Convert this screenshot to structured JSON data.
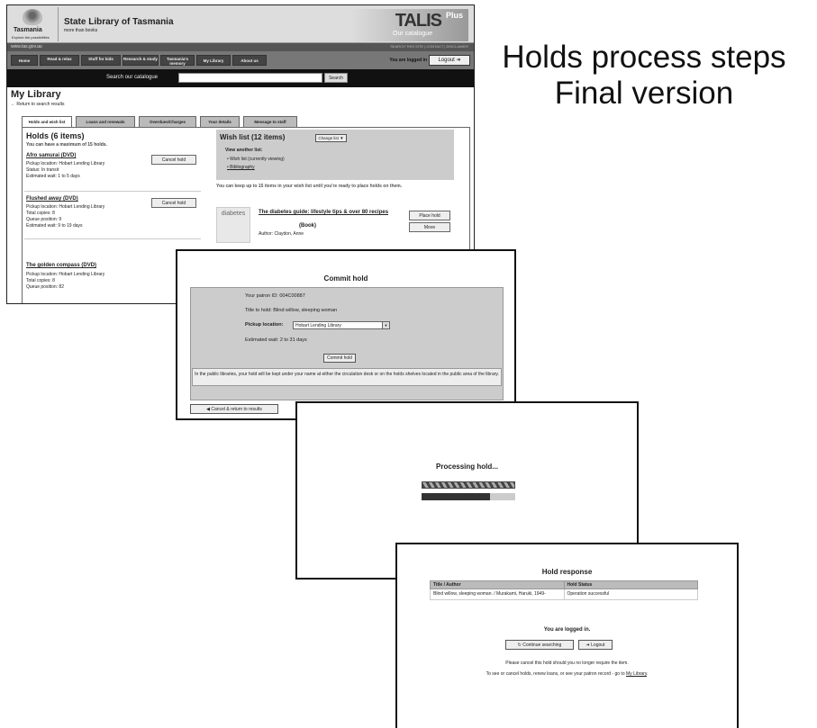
{
  "slide": {
    "title_line1": "Holds process steps",
    "title_line2": "Final version"
  },
  "my_library": {
    "logo_name": "Tasmania",
    "logo_tagline": "Explore the possibilities",
    "site_title": "State Library of Tasmania",
    "site_subtitle": "more than books",
    "talis_name": "TALIS",
    "talis_plus": "Plus",
    "talis_sub": "Our catalogue",
    "url": "www.tas.gov.au",
    "top_links": "SEARCH THIS SITE | CONTACT | DISCLAIMER",
    "nav": [
      "Home",
      "Read & relax",
      "Stuff for kids",
      "Research & study",
      "Tasmania's memory",
      "My Library",
      "About us"
    ],
    "logged_in": "You are logged in",
    "logout": "Logout",
    "search_label": "Search our catalogue",
    "search_button": "Search",
    "page_title": "My Library",
    "return_link": "← Return to search results",
    "tabs": [
      "Holds and wish list",
      "Loans and renewals",
      "Overdues/Charges",
      "Your details",
      "Message to staff"
    ],
    "holds_title": "Holds (6 items)",
    "holds_max": "You can have a maximum of 15 holds.",
    "cancel_hold": "Cancel hold",
    "holds": [
      {
        "title": "Afro samurai",
        "type": "(DVD)",
        "lines": [
          "Pickup location: Hobart Lending Library",
          "Status: In transit",
          "Estimated wait: 1 to 5 days"
        ]
      },
      {
        "title": "Flushed away",
        "type": "(DVD)",
        "lines": [
          "Pickup location: Hobart Lending Library",
          "Total copies: 8",
          "Queue position: 9",
          "Estimated wait: 9 to 19 days"
        ]
      },
      {
        "title": "The golden compass",
        "type": "(DVD)",
        "lines": [
          "Pickup location: Hobart Lending Library",
          "Total copies: 8",
          "Queue position: 82"
        ]
      }
    ],
    "wish_title": "Wish list (12 items)",
    "change_list": "Change list",
    "view_another": "View another list:",
    "wish_lists": [
      "• Wish list (currently viewing)",
      "• Bibliography"
    ],
    "wish_info": "You can keep up to 15 items in your wish list until you're ready to place holds on them.",
    "book_cover": "diabetes",
    "book_title": "The diabetes guide: lifestyle tips & over 80 recipes",
    "book_type": "(Book)",
    "book_author": "Author: Claydon, Anne",
    "place_hold": "Place hold",
    "move": "Move"
  },
  "commit_hold": {
    "title": "Commit hold",
    "patron_id": "Your patron ID: 004C00887",
    "title_to_hold": "Title to hold: Blind willow, sleeping woman",
    "pickup_label": "Pickup location:",
    "pickup_value": "Hobart Lending Library",
    "estimated_wait": "Estimated wait: 2 to 31 days",
    "commit_button": "Commit hold",
    "note": "In the public libraries, your hold will be kept under your name at either the circulation desk or on the holds shelves located in the public area of the library.",
    "cancel_button": "Cancel & return to results"
  },
  "processing": {
    "title": "Processing hold...",
    "progress_fraction": 0.73
  },
  "hold_response": {
    "title": "Hold response",
    "col_title": "Title / Author",
    "col_status": "Hold Status",
    "row_title": "Blind willow, sleeping woman. / Murakami, Haruki, 1949-",
    "row_status": "Operation successful",
    "logged_in": "You are logged in.",
    "continue_button": "Continue searching",
    "logout_button": "Logout",
    "cancel_note": "Please cancel this hold should you no longer require the item.",
    "see_note": "To see or cancel holds, renew loans, or see your patron record - go to",
    "my_library_link": "My Library",
    "period": "."
  }
}
